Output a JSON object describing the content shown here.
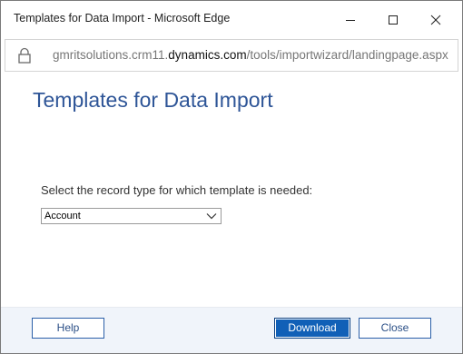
{
  "window": {
    "title": "Templates for Data Import - Microsoft Edge",
    "controls": {
      "minimize_icon": "minimize-icon",
      "maximize_icon": "maximize-icon",
      "close_icon": "close-icon"
    }
  },
  "address_bar": {
    "lock_icon": "lock-icon",
    "url_prefix": "gmritsolutions.crm11.",
    "url_domain": "dynamics.com",
    "url_path": "/tools/importwizard/landingpage.aspx"
  },
  "page": {
    "title": "Templates for Data Import",
    "prompt": "Select the record type for which template is needed:",
    "record_type_select": {
      "selected": "Account",
      "chevron_icon": "chevron-down-icon"
    }
  },
  "footer": {
    "help_label": "Help",
    "download_label": "Download",
    "close_label": "Close"
  },
  "colors": {
    "title_blue": "#2e5597",
    "primary_button": "#1160b7",
    "footer_bg": "#f0f4fa"
  }
}
